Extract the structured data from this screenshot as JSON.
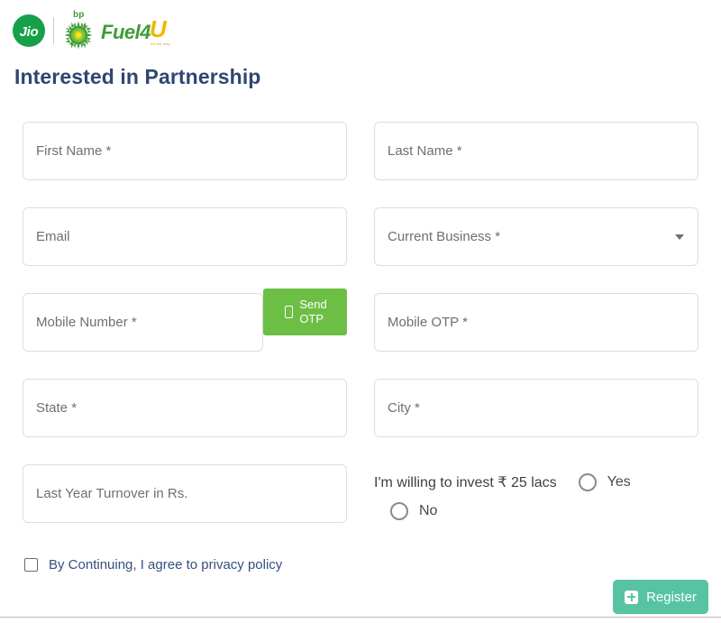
{
  "brand": {
    "jio_label": "Jio",
    "bp_label": "bp",
    "fuel_label": "Fuel4",
    "fuel_u_label": "U",
    "fuel_tagline": "for the way"
  },
  "header": {
    "title": "Interested in Partnership"
  },
  "form": {
    "fields": {
      "first_name": {
        "placeholder": "First Name *"
      },
      "last_name": {
        "placeholder": "Last Name *"
      },
      "email": {
        "placeholder": "Email"
      },
      "current_business": {
        "placeholder": "Current Business *",
        "options": []
      },
      "mobile_number": {
        "placeholder": "Mobile Number *"
      },
      "mobile_otp": {
        "placeholder": "Mobile OTP *"
      },
      "state": {
        "placeholder": "State *"
      },
      "city": {
        "placeholder": "City *"
      },
      "turnover": {
        "placeholder": "Last Year Turnover in Rs."
      }
    },
    "send_otp_label": "Send\nOTP",
    "invest": {
      "question": "I'm willing to invest ₹ 25 lacs",
      "yes_label": "Yes",
      "no_label": "No",
      "selected": ""
    },
    "consent": {
      "label": "By Continuing, I agree to privacy policy",
      "checked": false
    },
    "submit_label": "Register"
  },
  "colors": {
    "title": "#2e4672",
    "send_otp": "#6dbe45",
    "register": "#57c3a2",
    "jio_green": "#17a04a",
    "bp_green": "#3f9c35",
    "fuel_yellow": "#f2b705",
    "consent_text": "#35507e"
  }
}
